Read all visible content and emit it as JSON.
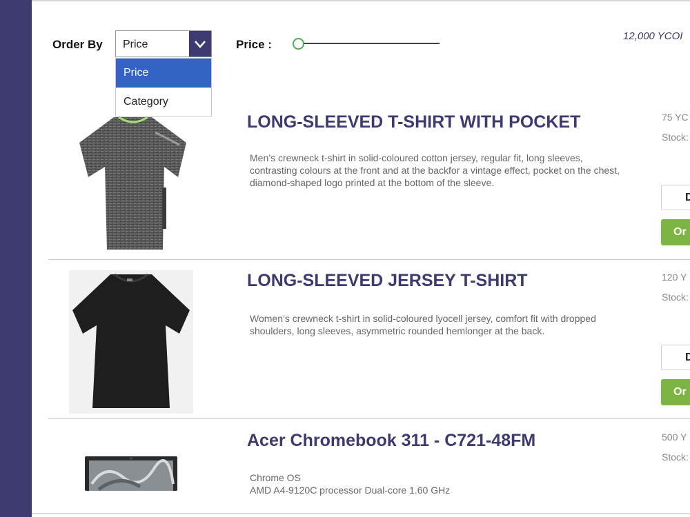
{
  "filters": {
    "order_by_label": "Order By",
    "order_by_selected": "Price",
    "order_by_options": [
      "Price",
      "Category"
    ],
    "price_label": "Price :",
    "price_slider_level": 0
  },
  "balance": "12,000  YCOI",
  "products": [
    {
      "title": "LONG-SLEEVED T-SHIRT WITH POCKET",
      "description": "Men’s crewneck t-shirt in solid-coloured cotton jersey, regular fit, long sleeves, contrasting colours at the front and at the backfor a vintage effect, pocket on the chest, diamond-shaped logo printed at the bottom of the sleeve.",
      "price": "75 YC",
      "stock": "Stock:",
      "details_button": "D",
      "order_button": "Or"
    },
    {
      "title": "LONG-SLEEVED JERSEY T-SHIRT",
      "description": "Women’s crewneck t-shirt in solid-coloured lyocell jersey, comfort fit with dropped shoulders, long sleeves, asymmetric rounded hemlonger at the back.",
      "price": "120 Y",
      "stock": "Stock:",
      "details_button": "D",
      "order_button": "Or"
    },
    {
      "title": "Acer Chromebook 311 - C721-48FM",
      "description_lines": [
        "Chrome OS",
        "AMD A4-9120C processor Dual-core 1.60 GHz"
      ],
      "price": "500 Y",
      "stock": "Stock:"
    }
  ],
  "colors": {
    "rail": "#3c3a6e",
    "title": "#3c3a6e",
    "dropdown_active": "#3462c4",
    "order_button": "#7cb342",
    "slider_knob": "#4caf50"
  }
}
